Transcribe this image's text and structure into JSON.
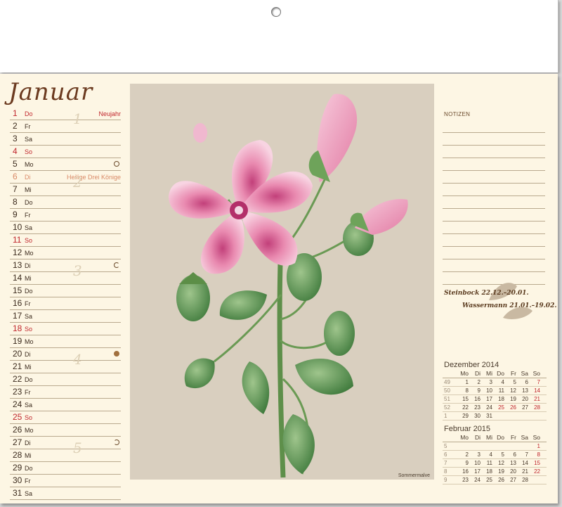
{
  "month": "Januar",
  "days": [
    {
      "n": "1",
      "wd": "Do",
      "type": "sun",
      "holiday": "Neujahr",
      "moon": ""
    },
    {
      "n": "2",
      "wd": "Fr",
      "type": "",
      "holiday": "",
      "moon": ""
    },
    {
      "n": "3",
      "wd": "Sa",
      "type": "",
      "holiday": "",
      "moon": ""
    },
    {
      "n": "4",
      "wd": "So",
      "type": "sun",
      "holiday": "",
      "moon": ""
    },
    {
      "n": "5",
      "wd": "Mo",
      "type": "",
      "holiday": "",
      "moon": "new"
    },
    {
      "n": "6",
      "wd": "Di",
      "type": "hol",
      "holiday": "Heilige Drei Könige",
      "moon": ""
    },
    {
      "n": "7",
      "wd": "Mi",
      "type": "",
      "holiday": "",
      "moon": ""
    },
    {
      "n": "8",
      "wd": "Do",
      "type": "",
      "holiday": "",
      "moon": ""
    },
    {
      "n": "9",
      "wd": "Fr",
      "type": "",
      "holiday": "",
      "moon": ""
    },
    {
      "n": "10",
      "wd": "Sa",
      "type": "",
      "holiday": "",
      "moon": ""
    },
    {
      "n": "11",
      "wd": "So",
      "type": "sun",
      "holiday": "",
      "moon": ""
    },
    {
      "n": "12",
      "wd": "Mo",
      "type": "",
      "holiday": "",
      "moon": ""
    },
    {
      "n": "13",
      "wd": "Di",
      "type": "",
      "holiday": "",
      "moon": "last"
    },
    {
      "n": "14",
      "wd": "Mi",
      "type": "",
      "holiday": "",
      "moon": ""
    },
    {
      "n": "15",
      "wd": "Do",
      "type": "",
      "holiday": "",
      "moon": ""
    },
    {
      "n": "16",
      "wd": "Fr",
      "type": "",
      "holiday": "",
      "moon": ""
    },
    {
      "n": "17",
      "wd": "Sa",
      "type": "",
      "holiday": "",
      "moon": ""
    },
    {
      "n": "18",
      "wd": "So",
      "type": "sun",
      "holiday": "",
      "moon": ""
    },
    {
      "n": "19",
      "wd": "Mo",
      "type": "",
      "holiday": "",
      "moon": ""
    },
    {
      "n": "20",
      "wd": "Di",
      "type": "",
      "holiday": "",
      "moon": "full"
    },
    {
      "n": "21",
      "wd": "Mi",
      "type": "",
      "holiday": "",
      "moon": ""
    },
    {
      "n": "22",
      "wd": "Do",
      "type": "",
      "holiday": "",
      "moon": ""
    },
    {
      "n": "23",
      "wd": "Fr",
      "type": "",
      "holiday": "",
      "moon": ""
    },
    {
      "n": "24",
      "wd": "Sa",
      "type": "",
      "holiday": "",
      "moon": ""
    },
    {
      "n": "25",
      "wd": "So",
      "type": "sun",
      "holiday": "",
      "moon": ""
    },
    {
      "n": "26",
      "wd": "Mo",
      "type": "",
      "holiday": "",
      "moon": ""
    },
    {
      "n": "27",
      "wd": "Di",
      "type": "",
      "holiday": "",
      "moon": "first"
    },
    {
      "n": "28",
      "wd": "Mi",
      "type": "",
      "holiday": "",
      "moon": ""
    },
    {
      "n": "29",
      "wd": "Do",
      "type": "",
      "holiday": "",
      "moon": ""
    },
    {
      "n": "30",
      "wd": "Fr",
      "type": "",
      "holiday": "",
      "moon": ""
    },
    {
      "n": "31",
      "wd": "Sa",
      "type": "",
      "holiday": "",
      "moon": ""
    }
  ],
  "weeks": [
    "1",
    "2",
    "3",
    "4",
    "5"
  ],
  "art_caption": "Sommermalve",
  "notes_label": "NOTIZEN",
  "zodiac": {
    "line1": "Steinbock 22.12.–20.01.",
    "line2": "Wassermann 21.01.–19.02."
  },
  "mini_headers": [
    "Mo",
    "Di",
    "Mi",
    "Do",
    "Fr",
    "Sa",
    "So"
  ],
  "mini_calendars": [
    {
      "title": "Dezember 2014",
      "rows": [
        {
          "w": "49",
          "d": [
            "1",
            "2",
            "3",
            "4",
            "5",
            "6",
            "7"
          ],
          "red": [
            6
          ],
          "hol": []
        },
        {
          "w": "50",
          "d": [
            "8",
            "9",
            "10",
            "11",
            "12",
            "13",
            "14"
          ],
          "red": [
            6
          ],
          "hol": []
        },
        {
          "w": "51",
          "d": [
            "15",
            "16",
            "17",
            "18",
            "19",
            "20",
            "21"
          ],
          "red": [
            6
          ],
          "hol": []
        },
        {
          "w": "52",
          "d": [
            "22",
            "23",
            "24",
            "25",
            "26",
            "27",
            "28"
          ],
          "red": [
            3,
            4,
            6
          ],
          "hol": []
        },
        {
          "w": "1",
          "d": [
            "29",
            "30",
            "31",
            "",
            "",
            "",
            ""
          ],
          "red": [],
          "hol": []
        }
      ]
    },
    {
      "title": "Februar 2015",
      "rows": [
        {
          "w": "5",
          "d": [
            "",
            "",
            "",
            "",
            "",
            "",
            "1"
          ],
          "red": [
            6
          ],
          "hol": []
        },
        {
          "w": "6",
          "d": [
            "2",
            "3",
            "4",
            "5",
            "6",
            "7",
            "8"
          ],
          "red": [
            6
          ],
          "hol": []
        },
        {
          "w": "7",
          "d": [
            "9",
            "10",
            "11",
            "12",
            "13",
            "14",
            "15"
          ],
          "red": [
            6
          ],
          "hol": []
        },
        {
          "w": "8",
          "d": [
            "16",
            "17",
            "18",
            "19",
            "20",
            "21",
            "22"
          ],
          "red": [
            6
          ],
          "hol": []
        },
        {
          "w": "9",
          "d": [
            "23",
            "24",
            "25",
            "26",
            "27",
            "28",
            ""
          ],
          "red": [],
          "hol": []
        }
      ]
    }
  ]
}
